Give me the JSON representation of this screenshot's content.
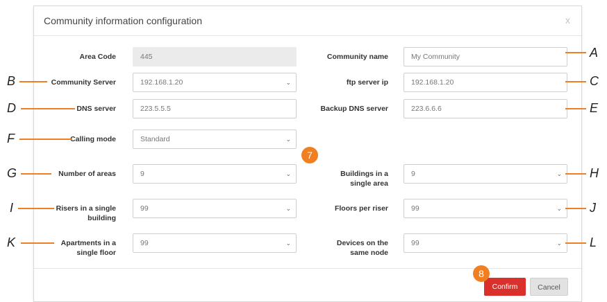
{
  "dialog": {
    "title": "Community information configuration",
    "close_glyph": "x"
  },
  "fields": {
    "area_code": {
      "label": "Area Code",
      "value": "445"
    },
    "community_name": {
      "label": "Community name",
      "placeholder": "My Community"
    },
    "community_server": {
      "label": "Community Server",
      "value": "192.168.1.20"
    },
    "ftp_server_ip": {
      "label": "ftp server ip",
      "value": "192.168.1.20"
    },
    "dns_server": {
      "label": "DNS server",
      "value": "223.5.5.5"
    },
    "backup_dns_server": {
      "label": "Backup DNS server",
      "value": "223.6.6.6"
    },
    "calling_mode": {
      "label": "Calling mode",
      "value": "Standard"
    },
    "number_of_areas": {
      "label": "Number of areas",
      "value": "9"
    },
    "buildings_in_area": {
      "label_line1": "Buildings in a",
      "label_line2": "single area",
      "value": "9"
    },
    "risers_in_building": {
      "label_line1": "Risers in a single",
      "label_line2": "building",
      "value": "99"
    },
    "floors_per_riser": {
      "label": "Floors per riser",
      "value": "99"
    },
    "apartments_in_floor": {
      "label_line1": "Apartments in a",
      "label_line2": "single floor",
      "value": "99"
    },
    "devices_on_node": {
      "label_line1": "Devices on the",
      "label_line2": "same node",
      "value": "99"
    }
  },
  "buttons": {
    "confirm": "Confirm",
    "cancel": "Cancel"
  },
  "badges": {
    "step_7": "7",
    "step_8": "8"
  },
  "annotations": {
    "A": "A",
    "B": "B",
    "C": "C",
    "D": "D",
    "E": "E",
    "F": "F",
    "G": "G",
    "H": "H",
    "I": "I",
    "J": "J",
    "K": "K",
    "L": "L"
  },
  "colors": {
    "accent": "#f07f22",
    "confirm": "#d9302b"
  },
  "icons": {
    "dropdown": "chevron-down-icon",
    "close": "close-icon"
  }
}
